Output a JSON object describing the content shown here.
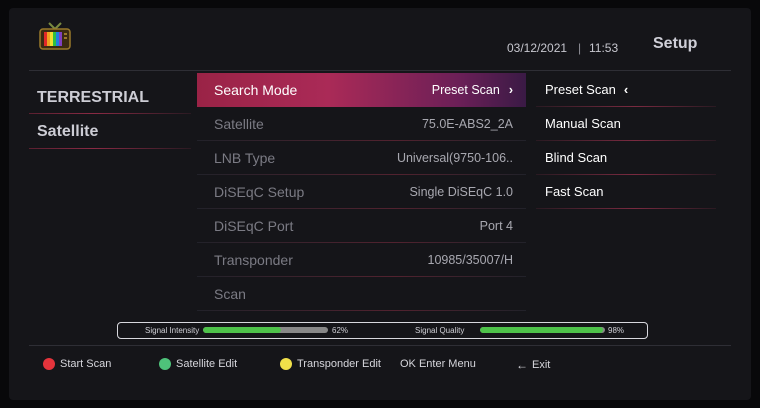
{
  "header": {
    "date": "03/12/2021",
    "separator": "|",
    "time": "11:53",
    "title": "Setup",
    "logo_icon": "tv-icon"
  },
  "left_menu": {
    "items": [
      {
        "label": "TERRESTRIAL"
      },
      {
        "label": "Satellite"
      }
    ]
  },
  "settings": {
    "rows": [
      {
        "label": "Search Mode",
        "value": "Preset Scan",
        "active": true
      },
      {
        "label": "Satellite",
        "value": "75.0E-ABS2_2A"
      },
      {
        "label": "LNB Type",
        "value": "Universal(9750-106.."
      },
      {
        "label": "DiSEqC Setup",
        "value": "Single DiSEqC 1.0"
      },
      {
        "label": "DiSEqC Port",
        "value": "Port 4"
      },
      {
        "label": "Transponder",
        "value": "10985/35007/H"
      },
      {
        "label": "Scan",
        "value": ""
      }
    ],
    "chevron": "›"
  },
  "options": {
    "items": [
      {
        "label": "Preset Scan",
        "selected": true
      },
      {
        "label": "Manual Scan"
      },
      {
        "label": "Blind Scan"
      },
      {
        "label": "Fast Scan"
      }
    ],
    "chevron": "‹"
  },
  "signal": {
    "intensity_label": "Signal Intensity",
    "intensity_value": 62,
    "intensity_text": "62%",
    "quality_label": "Signal Quality",
    "quality_value": 98,
    "quality_text": "98%",
    "fill_color": "#4ec24a"
  },
  "footer": {
    "start_scan": "Start Scan",
    "satellite_edit": "Satellite Edit",
    "transponder_edit": "Transponder Edit",
    "ok_label": "OK Enter Menu",
    "exit_arrow": "←",
    "exit_label": "Exit",
    "colors": {
      "red": "#e5343c",
      "green": "#4ec27a",
      "yellow": "#f0e04a"
    }
  }
}
